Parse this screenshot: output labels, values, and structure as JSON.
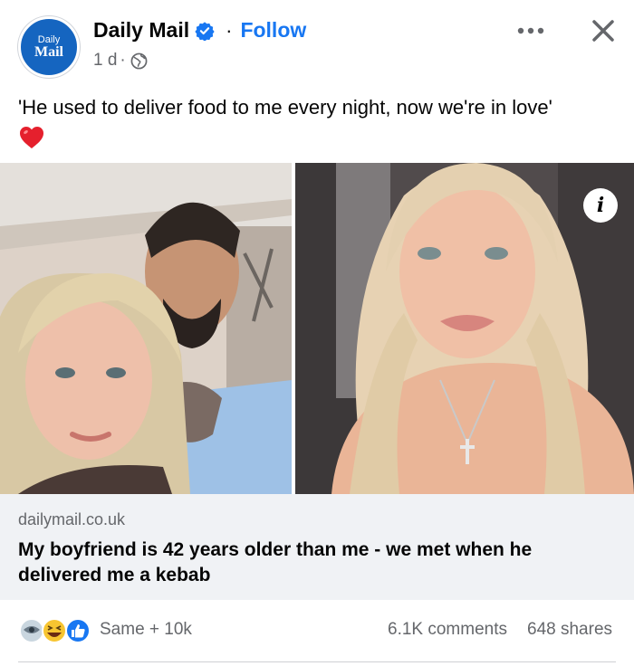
{
  "post": {
    "page_name": "Daily Mail",
    "avatar_logo": "Daily Mail",
    "follow_label": "Follow",
    "separator": "·",
    "time": "1 d",
    "meta_separator": "·",
    "audience_icon": "globe-icon",
    "more_icon": "more-horizontal-icon",
    "close_icon": "close-icon",
    "caption": "'He used to deliver food to me every night, now we're in love'",
    "caption_emoji": "red-heart-icon"
  },
  "link_preview": {
    "domain": "dailymail.co.uk",
    "headline": "My boyfriend is 42 years older than me - we met when he delivered me a kebab",
    "info_label": "i"
  },
  "stats": {
    "reaction_icons": [
      "custom-reaction-icon",
      "haha-icon",
      "like-icon"
    ],
    "reactions_label": "Same + 10k",
    "comments": "6.1K comments",
    "shares": "648 shares"
  },
  "colors": {
    "brand_blue": "#1877f2",
    "daily_mail_blue": "#1565c0",
    "secondary_text": "#65676b",
    "link_box_bg": "#f0f2f5"
  }
}
